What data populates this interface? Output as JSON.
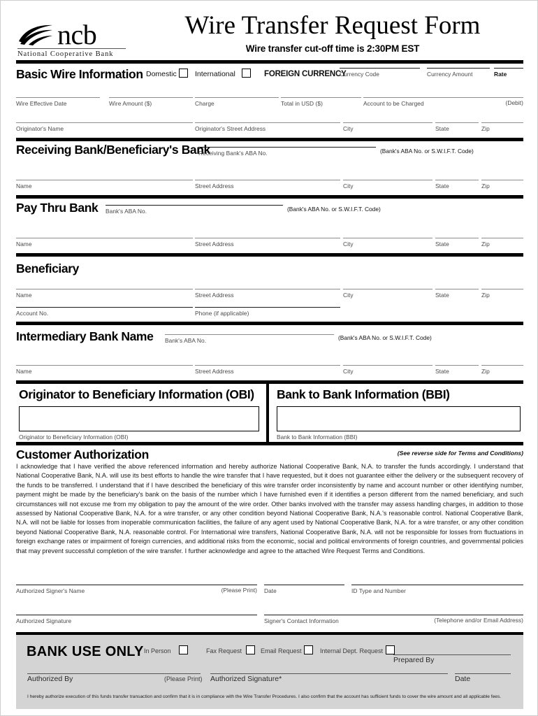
{
  "header": {
    "logo_word": "ncb",
    "logo_subtitle": "National Cooperative Bank",
    "title": "Wire Transfer Request Form",
    "subtitle": "Wire transfer cut-off time is 2:30PM EST"
  },
  "basic": {
    "section_title": "Basic Wire Information",
    "domestic_label": "Domestic",
    "international_label": "International",
    "foreign_currency_label": "FOREIGN CURRENCY",
    "currency_code_caption": "Currency Code",
    "currency_amount_caption": "Currency Amount",
    "rate_caption": "Rate",
    "row1": [
      "Wire Effective Date",
      "Wire Amount ($)",
      "Charge",
      "Total in USD ($)",
      "Account to be Charged"
    ],
    "debit_caption": "(Debit)",
    "row2": [
      "Originator's Name",
      "Originator's Street Address",
      "City",
      "State",
      "Zip"
    ]
  },
  "receiving": {
    "section_title": "Receiving Bank/Beneficiary's Bank",
    "aba_caption": "Receiving Bank's ABA No.",
    "aba_note": "(Bank's ABA No. or S.W.I.F.T. Code)",
    "row": [
      "Name",
      "Street Address",
      "City",
      "State",
      "Zip"
    ]
  },
  "paythru": {
    "section_title": "Pay Thru Bank",
    "aba_caption": "Bank's ABA No.",
    "aba_note": "(Bank's ABA No. or S.W.I.F.T. Code)",
    "row": [
      "Name",
      "Street Address",
      "City",
      "State",
      "Zip"
    ]
  },
  "beneficiary": {
    "section_title": "Beneficiary",
    "row": [
      "Name",
      "Street Address",
      "City",
      "State",
      "Zip"
    ],
    "account_caption": "Account No.",
    "phone_caption": "Phone (if applicable)"
  },
  "intermediary": {
    "section_title": "Intermediary Bank Name",
    "aba_caption": "Bank's ABA No.",
    "aba_note": "(Bank's ABA No. or S.W.I.F.T. Code)",
    "row": [
      "Name",
      "Street Address",
      "City",
      "State",
      "Zip"
    ]
  },
  "obi": {
    "title": "Originator to Beneficiary Information (OBI)",
    "caption": "Originator to Beneficiary Information (OBI)",
    "value": ""
  },
  "bbi": {
    "title": "Bank to Bank Information (BBI)",
    "caption": "Bank to Bank Information (BBI)",
    "value": ""
  },
  "authorization": {
    "title": "Customer Authorization",
    "reverse_note": "(See reverse side for Terms and Conditions)",
    "paragraph": "I acknowledge that I have verified the above referenced information and hereby authorize National Cooperative Bank, N.A. to transfer the funds accordingly. I understand that National Cooperative Bank, N.A. will use its best efforts to handle the wire transfer that I have requested, but it does not guarantee either the delivery or the subsequent recovery of the funds to be transferred. I understand that if I have described the beneficiary of this wire transfer order inconsistently by name and account number or other identifying number, payment might be made by the beneficiary's bank on the basis of the number which I have furnished even if it identifies a person different from the named beneficiary, and such circumstances will not excuse me from my obligation to pay the amount of the wire order. Other banks involved with the transfer may assess handling charges, in addition to those assessed by National Cooperative Bank, N.A. for a wire transfer, or any other condition beyond National Cooperative Bank, N.A.'s reasonable control. National Cooperative Bank, N.A. will not be liable for losses from inoperable communication facilities, the failure of any agent used by National Cooperative Bank, N.A. for a wire transfer, or any other condition beyond National Cooperative Bank, N.A. reasonable control. For International wire transfers, National Cooperative Bank, N.A. will not be responsible for losses from fluctuations in foreign exchange rates or impairment of foreign currencies, and additional risks from the economic, social and political environments of foreign countries, and governmental policies that may prevent successful completion of the wire transfer. I further acknowledge and agree to the attached Wire Request Terms and Conditions.",
    "signer_name_caption": "Authorized Signer's Name",
    "please_print_caption": "(Please Print)",
    "date_caption": "Date",
    "id_caption": "ID Type and Number",
    "signature_caption": "Authorized Signature",
    "contact_caption": "Signer's Contact Information",
    "contact_note": "(Telephone and/or Email Address)"
  },
  "bank_use": {
    "title": "BANK USE ONLY",
    "checkboxes": [
      "In Person",
      "Fax Request",
      "Email Request",
      "Internal Dept. Request"
    ],
    "prepared_by_caption": "Prepared By",
    "authorized_by_caption": "Authorized By",
    "please_print_caption": "(Please Print)",
    "authorized_signature_caption": "Authorized Signature*",
    "date_caption": "Date",
    "fine_print": "I hereby authorize execution of this funds transfer transaction and confirm that it is in compliance with the Wire Transfer Procedures. I also confirm that the account has sufficient funds to cover the wire amount and all applicable fees."
  }
}
